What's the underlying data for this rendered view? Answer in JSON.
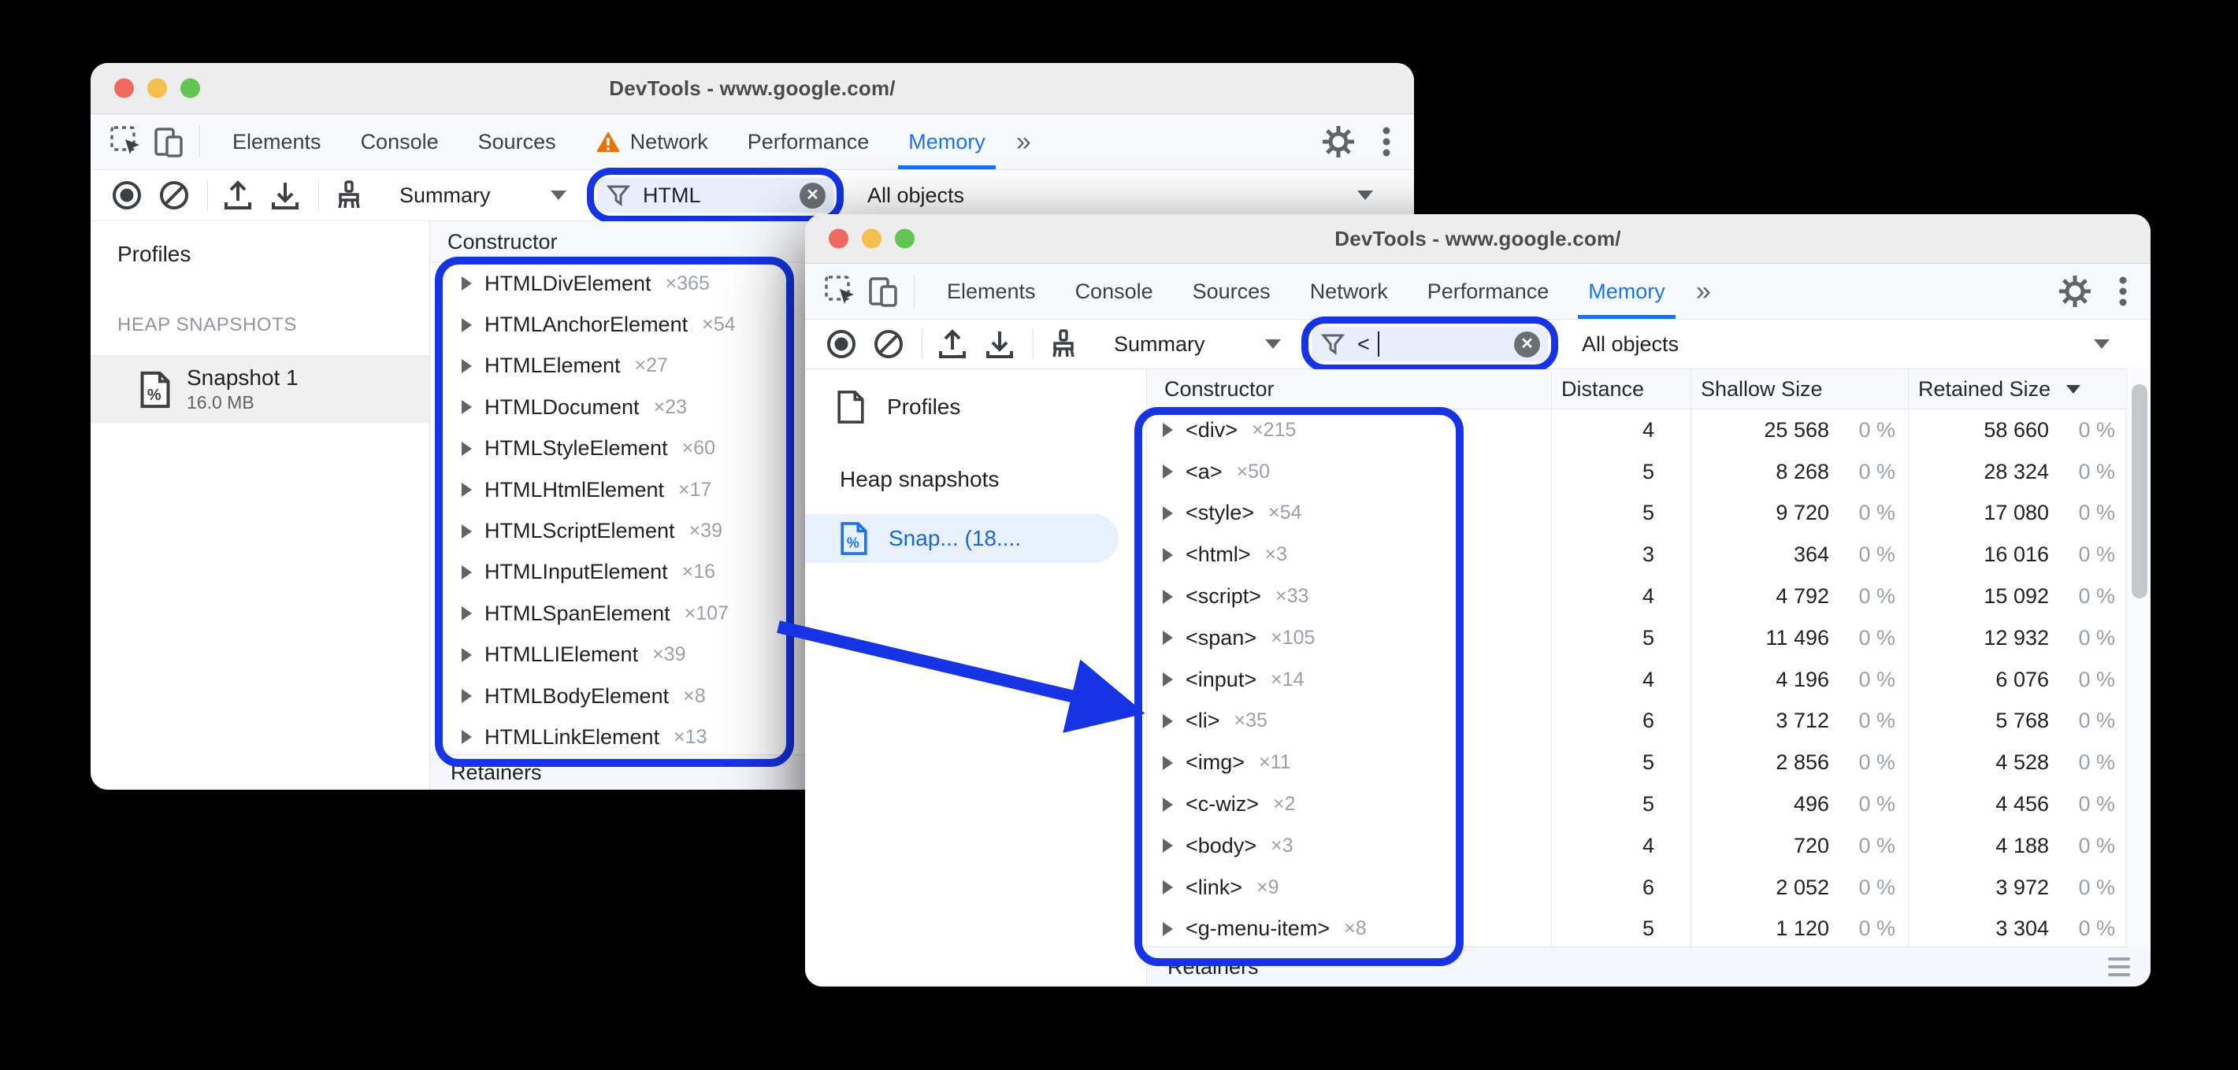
{
  "colors": {
    "annotation_blue": "#1634e4",
    "selected_tab_blue": "#1a73e8",
    "warning_orange": "#e8710a",
    "background": "#000000",
    "snapshot_selected_bg": "#e8f0fe"
  },
  "back_window": {
    "title": "DevTools - www.google.com/",
    "more_tabs_glyph": "»",
    "tabs": [
      {
        "label": "Elements"
      },
      {
        "label": "Console"
      },
      {
        "label": "Sources"
      },
      {
        "label": "Network",
        "warn": true
      },
      {
        "label": "Performance"
      },
      {
        "label": "Memory",
        "selected": true
      }
    ],
    "toolbar": {
      "perspective": "Summary",
      "filter_value": "HTML",
      "class_filter": "All objects"
    },
    "sidebar": {
      "title": "Profiles",
      "section": "HEAP SNAPSHOTS",
      "snapshot_name": "Snapshot 1",
      "snapshot_size": "16.0 MB"
    },
    "grid": {
      "constructor_header": "Constructor",
      "retainers": "Retainers",
      "rows": [
        {
          "name": "HTMLDivElement",
          "count": "×365"
        },
        {
          "name": "HTMLAnchorElement",
          "count": "×54"
        },
        {
          "name": "HTMLElement",
          "count": "×27"
        },
        {
          "name": "HTMLDocument",
          "count": "×23"
        },
        {
          "name": "HTMLStyleElement",
          "count": "×60"
        },
        {
          "name": "HTMLHtmlElement",
          "count": "×17"
        },
        {
          "name": "HTMLScriptElement",
          "count": "×39"
        },
        {
          "name": "HTMLInputElement",
          "count": "×16"
        },
        {
          "name": "HTMLSpanElement",
          "count": "×107"
        },
        {
          "name": "HTMLLIElement",
          "count": "×39"
        },
        {
          "name": "HTMLBodyElement",
          "count": "×8"
        },
        {
          "name": "HTMLLinkElement",
          "count": "×13"
        }
      ]
    }
  },
  "front_window": {
    "title": "DevTools - www.google.com/",
    "more_tabs_glyph": "»",
    "tabs": [
      {
        "label": "Elements"
      },
      {
        "label": "Console"
      },
      {
        "label": "Sources"
      },
      {
        "label": "Network"
      },
      {
        "label": "Performance"
      },
      {
        "label": "Memory",
        "selected": true
      }
    ],
    "toolbar": {
      "perspective": "Summary",
      "filter_value": "<",
      "class_filter": "All objects"
    },
    "sidebar": {
      "title": "Profiles",
      "section": "Heap snapshots",
      "snapshot_label": "Snap...  (18...."
    },
    "grid": {
      "headers": {
        "constructor": "Constructor",
        "distance": "Distance",
        "shallow": "Shallow Size",
        "retained": "Retained Size"
      },
      "retainers": "Retainers",
      "rows": [
        {
          "name": "<div>",
          "count": "×215",
          "distance": "4",
          "shallow": "25 568",
          "shallow_pct": "0 %",
          "retained": "58 660",
          "retained_pct": "0 %"
        },
        {
          "name": "<a>",
          "count": "×50",
          "distance": "5",
          "shallow": "8 268",
          "shallow_pct": "0 %",
          "retained": "28 324",
          "retained_pct": "0 %"
        },
        {
          "name": "<style>",
          "count": "×54",
          "distance": "5",
          "shallow": "9 720",
          "shallow_pct": "0 %",
          "retained": "17 080",
          "retained_pct": "0 %"
        },
        {
          "name": "<html>",
          "count": "×3",
          "distance": "3",
          "shallow": "364",
          "shallow_pct": "0 %",
          "retained": "16 016",
          "retained_pct": "0 %"
        },
        {
          "name": "<script>",
          "count": "×33",
          "distance": "4",
          "shallow": "4 792",
          "shallow_pct": "0 %",
          "retained": "15 092",
          "retained_pct": "0 %"
        },
        {
          "name": "<span>",
          "count": "×105",
          "distance": "5",
          "shallow": "11 496",
          "shallow_pct": "0 %",
          "retained": "12 932",
          "retained_pct": "0 %"
        },
        {
          "name": "<input>",
          "count": "×14",
          "distance": "4",
          "shallow": "4 196",
          "shallow_pct": "0 %",
          "retained": "6 076",
          "retained_pct": "0 %"
        },
        {
          "name": "<li>",
          "count": "×35",
          "distance": "6",
          "shallow": "3 712",
          "shallow_pct": "0 %",
          "retained": "5 768",
          "retained_pct": "0 %"
        },
        {
          "name": "<img>",
          "count": "×11",
          "distance": "5",
          "shallow": "2 856",
          "shallow_pct": "0 %",
          "retained": "4 528",
          "retained_pct": "0 %"
        },
        {
          "name": "<c-wiz>",
          "count": "×2",
          "distance": "5",
          "shallow": "496",
          "shallow_pct": "0 %",
          "retained": "4 456",
          "retained_pct": "0 %"
        },
        {
          "name": "<body>",
          "count": "×3",
          "distance": "4",
          "shallow": "720",
          "shallow_pct": "0 %",
          "retained": "4 188",
          "retained_pct": "0 %"
        },
        {
          "name": "<link>",
          "count": "×9",
          "distance": "6",
          "shallow": "2 052",
          "shallow_pct": "0 %",
          "retained": "3 972",
          "retained_pct": "0 %"
        },
        {
          "name": "<g-menu-item>",
          "count": "×8",
          "distance": "5",
          "shallow": "1 120",
          "shallow_pct": "0 %",
          "retained": "3 304",
          "retained_pct": "0 %"
        }
      ]
    }
  },
  "icons": {
    "window_controls": [
      "close-icon",
      "minimize-icon",
      "zoom-icon"
    ],
    "tab_strip": [
      "inspect-icon",
      "device-toolbar-icon",
      "warning-icon",
      "more-tabs-icon",
      "gear-icon",
      "kebab-menu-icon"
    ],
    "toolbar": [
      "record-icon",
      "block-icon",
      "upload-icon",
      "download-icon",
      "clear-brush-icon",
      "filter-funnel-icon",
      "clear-circle-icon",
      "dropdown-caret-icon"
    ],
    "sidebar": [
      "profile-document-icon",
      "heap-snapshot-icon"
    ],
    "grid": [
      "disclosure-triangle-icon",
      "sort-descending-icon",
      "hamburger-icon"
    ],
    "annotations": [
      "highlight-box",
      "arrow"
    ]
  }
}
